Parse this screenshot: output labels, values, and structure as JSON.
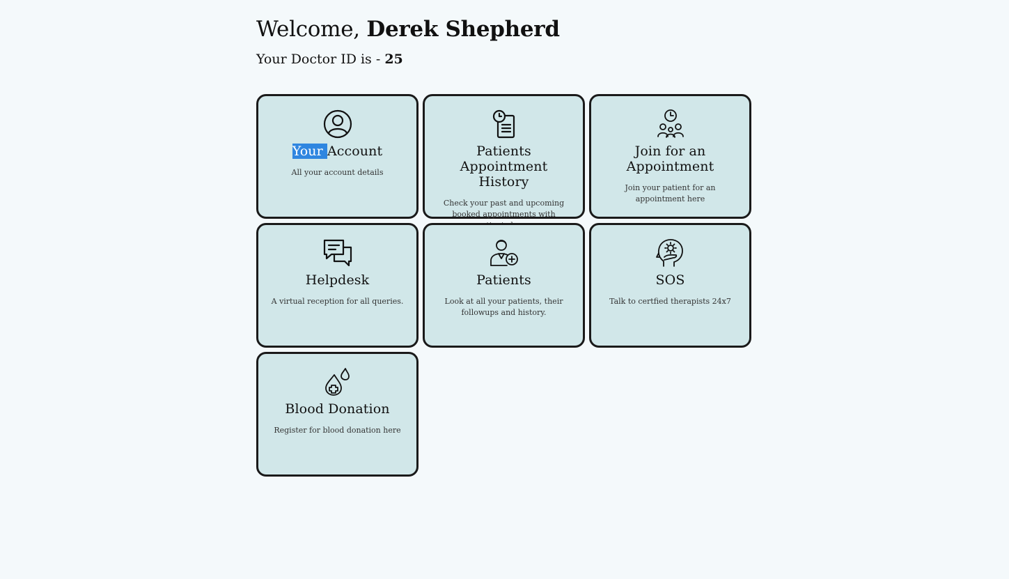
{
  "header": {
    "welcome_prefix": "Welcome, ",
    "doctor_name": "Derek Shepherd",
    "id_prefix": "Your Doctor ID is - ",
    "doctor_id": "25"
  },
  "cards": [
    {
      "title_selected": "Your ",
      "title_rest": "Account",
      "description": "All your account details",
      "icon": "user-circle-icon"
    },
    {
      "title": "Patients Appointment History",
      "description": "Check your past and upcoming booked appointments with patients here.",
      "icon": "clock-clipboard-icon"
    },
    {
      "title": "Join for an Appointment",
      "description": "Join your patient for an appointment here",
      "icon": "meeting-clock-icon"
    },
    {
      "title": "Helpdesk",
      "description": "A virtual reception for all queries.",
      "icon": "chat-bubbles-icon"
    },
    {
      "title": "Patients",
      "description": "Look at all your patients, their followups and history.",
      "icon": "doctor-plus-icon"
    },
    {
      "title": "SOS",
      "description": "Talk to certfied therapists 24x7",
      "icon": "mental-health-icon"
    },
    {
      "title": "Blood Donation",
      "description": "Register for blood donation here",
      "icon": "blood-drop-icon"
    }
  ],
  "colors": {
    "background": "#f4f9fb",
    "card_background": "#d1e7e9",
    "card_border": "#1a1a1a",
    "selection": "#2f86e0"
  }
}
